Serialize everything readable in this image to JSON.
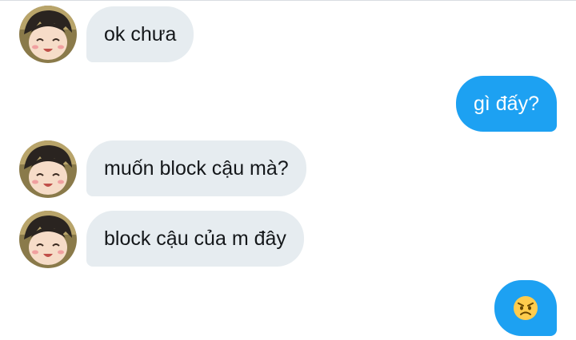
{
  "conversation": {
    "messages": [
      {
        "direction": "incoming",
        "text": "ok chưa"
      },
      {
        "direction": "outgoing",
        "text": "gì đấy?"
      },
      {
        "direction": "incoming",
        "text": "muốn block cậu mà?"
      },
      {
        "direction": "incoming",
        "text": "block cậu của m đây"
      },
      {
        "direction": "outgoing",
        "emoji": "angry-face"
      }
    ]
  },
  "colors": {
    "incoming_bubble": "#e6ecf0",
    "outgoing_bubble": "#1da1f2",
    "text_dark": "#14171a",
    "emoji_yellow": "#ffcc4d"
  }
}
